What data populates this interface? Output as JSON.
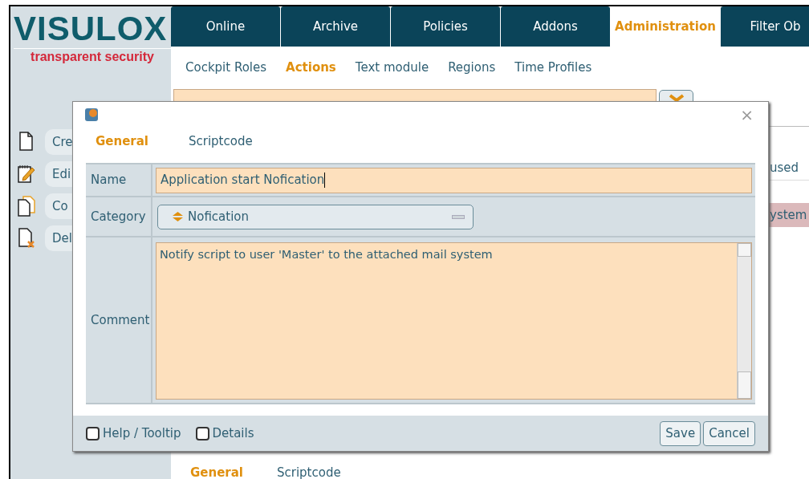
{
  "logo": {
    "name": "VISULOX",
    "tagline": "transparent security"
  },
  "tabs": [
    {
      "label": "Online",
      "selected": false
    },
    {
      "label": "Archive",
      "selected": false
    },
    {
      "label": "Policies",
      "selected": false
    },
    {
      "label": "Addons",
      "selected": false
    },
    {
      "label": "Administration",
      "selected": true
    },
    {
      "label": "Filter Ob",
      "selected": false
    }
  ],
  "subtabs": [
    {
      "label": "Cockpit Roles",
      "selected": false
    },
    {
      "label": "Actions",
      "selected": true
    },
    {
      "label": "Text module",
      "selected": false
    },
    {
      "label": "Regions",
      "selected": false
    },
    {
      "label": "Time Profiles",
      "selected": false
    }
  ],
  "sidebar": {
    "items": [
      {
        "kind": "create",
        "label": "Cre"
      },
      {
        "kind": "edit",
        "label": "Edi"
      },
      {
        "kind": "copy",
        "label": "Co"
      },
      {
        "kind": "delete",
        "label": "Del"
      }
    ]
  },
  "list": {
    "rows": [
      {
        "text": "used",
        "selected": false
      },
      {
        "text": "ystem",
        "selected": true
      }
    ]
  },
  "bottom_tabs": [
    {
      "label": "General",
      "selected": true
    },
    {
      "label": "Scriptcode",
      "selected": false
    }
  ],
  "dialog": {
    "close": "×",
    "tabs": [
      {
        "label": "General",
        "selected": true
      },
      {
        "label": "Scriptcode",
        "selected": false
      }
    ],
    "fields": [
      {
        "kind": "text",
        "label": "Name",
        "value": "Application start Nofication"
      },
      {
        "kind": "select",
        "label": "Category",
        "value": "Nofication"
      },
      {
        "kind": "textarea",
        "label": "Comment",
        "value": "Notify script to user 'Master' to the attached mail system"
      }
    ],
    "options": [
      {
        "label": "Help / Tooltip",
        "checked": false
      },
      {
        "label": "Details",
        "checked": false
      }
    ],
    "buttons": [
      "Save",
      "Cancel"
    ]
  }
}
